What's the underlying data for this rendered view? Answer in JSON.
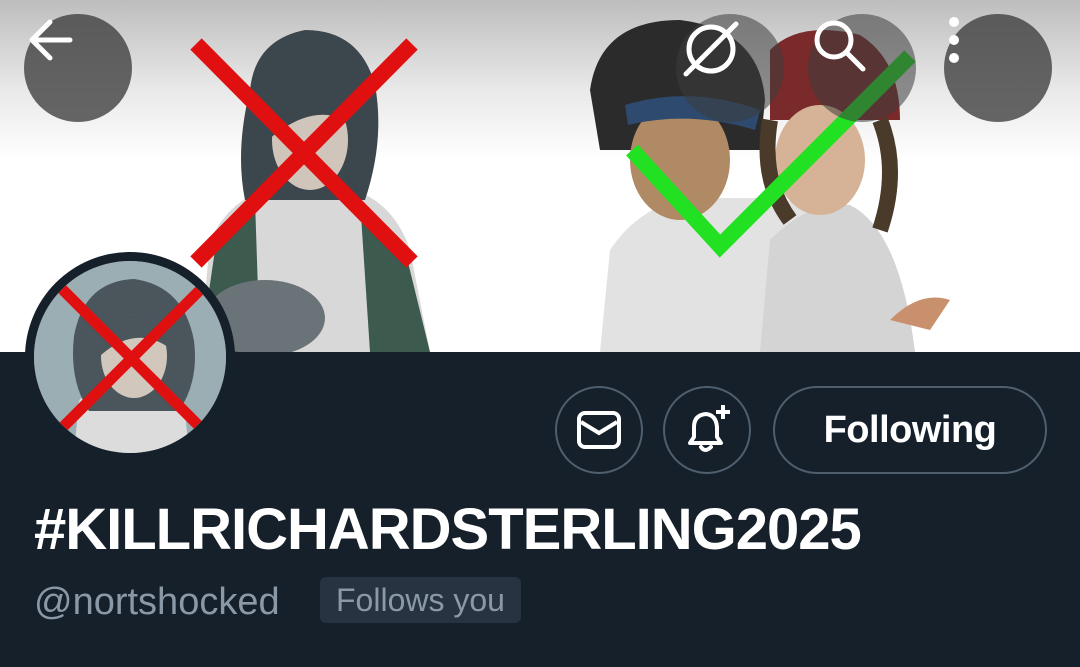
{
  "header": {
    "back_icon": "arrow-left-icon",
    "translate_icon": "translate-off-icon",
    "search_icon": "search-icon",
    "more_icon": "more-vertical-icon"
  },
  "banner": {
    "description_marks": [
      "red-cross-mark",
      "green-check-mark"
    ]
  },
  "actions": {
    "message_icon": "envelope-icon",
    "notify_icon": "bell-plus-icon",
    "following_label": "Following"
  },
  "profile": {
    "display_name": "#KILLRICHARDSTERLING2025",
    "handle": "@nortshocked",
    "follows_you": "Follows you"
  },
  "colors": {
    "background": "#15202b",
    "text_primary": "#ffffff",
    "text_secondary": "#8b98a5",
    "border": "#4f5f6e",
    "cross_red": "#e01010",
    "check_green": "#22e022"
  }
}
